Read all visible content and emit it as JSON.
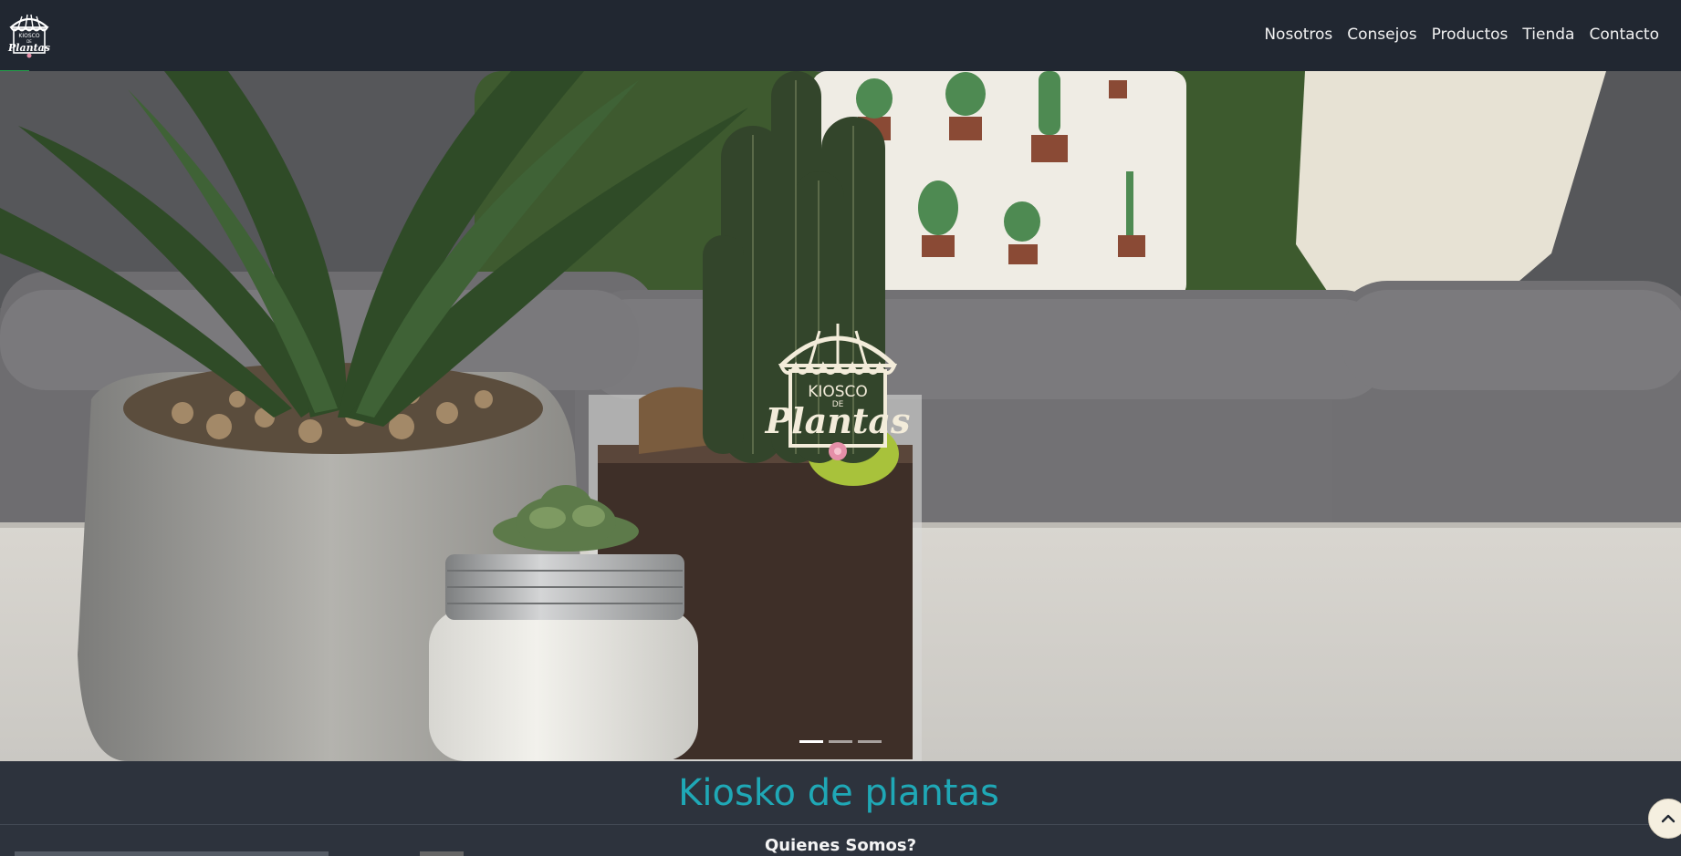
{
  "brand": {
    "line1": "KIOSCO",
    "line2": "DE",
    "line3": "Plantas",
    "alt": "Kiosco de Plantas"
  },
  "nav": [
    {
      "label": "Nosotros"
    },
    {
      "label": "Consejos"
    },
    {
      "label": "Productos"
    },
    {
      "label": "Tienda"
    },
    {
      "label": "Contacto"
    }
  ],
  "carousel": {
    "indicators": 3,
    "active": 0
  },
  "section": {
    "title": "Kiosko de plantas",
    "subtitle": "Quienes Somos?"
  },
  "icons": {
    "scroll_top": "chevron-up-icon",
    "logo": "storefront-logo"
  },
  "colors": {
    "header_bg": "#212731",
    "page_bg": "#2d333d",
    "title": "#1fa8b6",
    "accent": "#22a34a"
  }
}
